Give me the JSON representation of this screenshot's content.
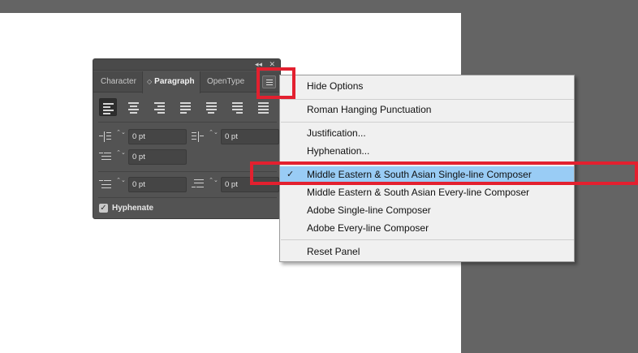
{
  "panel": {
    "tabs": [
      {
        "label": "Character"
      },
      {
        "label": "Paragraph",
        "active": true
      },
      {
        "label": "OpenType"
      }
    ],
    "collapse_glyph": "◂◂",
    "close_glyph": "✕",
    "stepper_glyph": "⌃⌄",
    "fields": {
      "left_indent": "0 pt",
      "right_indent": "0 pt",
      "first_line_indent": "0 pt",
      "space_before": "0 pt",
      "space_after": "0 pt"
    },
    "hyphenate": {
      "label": "Hyphenate",
      "checked": true
    }
  },
  "menu": {
    "items": [
      {
        "label": "Hide Options"
      },
      {
        "label": "Roman Hanging Punctuation"
      },
      {
        "label": "Justification..."
      },
      {
        "label": "Hyphenation..."
      },
      {
        "label": "Middle Eastern & South Asian Single-line Composer",
        "checked": true,
        "highlighted": true
      },
      {
        "label": "Middle Eastern & South Asian Every-line Composer"
      },
      {
        "label": "Adobe Single-line Composer"
      },
      {
        "label": "Adobe Every-line Composer"
      },
      {
        "label": "Reset Panel"
      }
    ],
    "check_glyph": "✓",
    "highlight_color": "#99ccf5"
  },
  "annotation_color": "#e3202f"
}
